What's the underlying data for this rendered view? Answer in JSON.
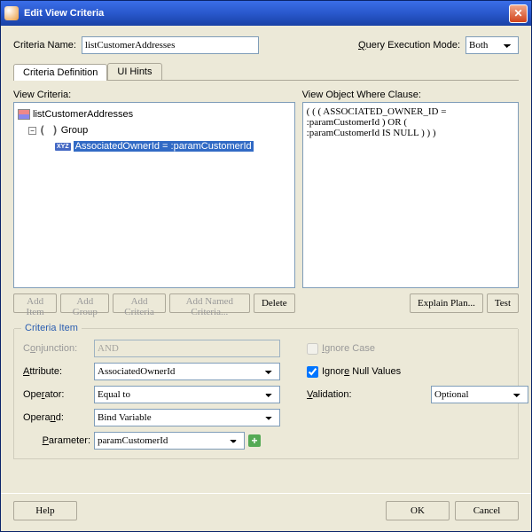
{
  "window": {
    "title": "Edit View Criteria"
  },
  "header": {
    "criteria_name_label": "Criteria Name:",
    "criteria_name_value": "listCustomerAddresses",
    "qem_label": "Query Execution Mode:",
    "qem_value": "Both"
  },
  "tabs": {
    "definition": "Criteria Definition",
    "hints": "UI Hints"
  },
  "view_criteria": {
    "label": "View Criteria:",
    "root": "listCustomerAddresses",
    "group": "Group",
    "item": "AssociatedOwnerId = :paramCustomerId"
  },
  "where_clause": {
    "label": "View Object Where Clause:",
    "text": "( ( ( ASSOCIATED_OWNER_ID =\n:paramCustomerId ) OR (\n:paramCustomerId IS NULL ) ) )"
  },
  "buttons": {
    "add_item": "Add Item",
    "add_group": "Add Group",
    "add_criteria": "Add Criteria",
    "add_named": "Add Named Criteria...",
    "delete": "Delete",
    "explain": "Explain Plan...",
    "test": "Test",
    "help": "Help",
    "ok": "OK",
    "cancel": "Cancel"
  },
  "criteria_item": {
    "title": "Criteria Item",
    "conjunction_label": "Conjunction:",
    "conjunction_value": "AND",
    "attribute_label": "Attribute:",
    "attribute_value": "AssociatedOwnerId",
    "operator_label": "Operator:",
    "operator_value": "Equal to",
    "operand_label": "Operand:",
    "operand_value": "Bind Variable",
    "parameter_label": "Parameter:",
    "parameter_value": "paramCustomerId",
    "ignore_case": "Ignore Case",
    "ignore_null": "Ignore Null Values",
    "validation_label": "Validation:",
    "validation_value": "Optional"
  }
}
